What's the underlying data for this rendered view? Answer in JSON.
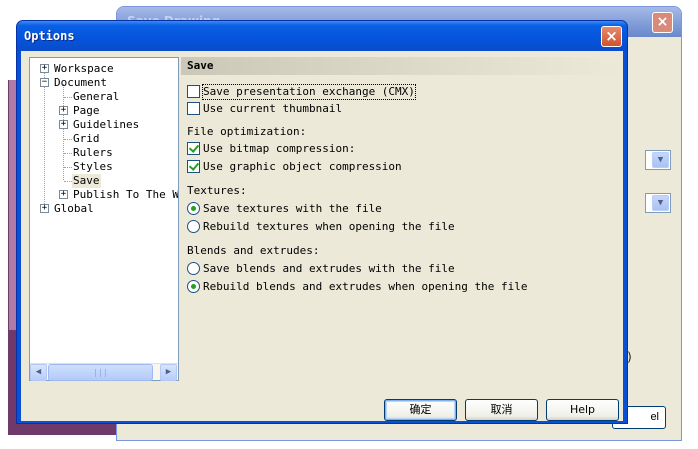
{
  "dialog": {
    "title": "Options",
    "close_label": "×"
  },
  "back_window": {
    "title": "Save Drawing",
    "close_label": "×",
    "glyph_right": ")",
    "fragment_text": "t",
    "cancel_fragment": "el"
  },
  "tree": {
    "items": [
      {
        "label": "Workspace",
        "expander": "+"
      },
      {
        "label": "Document",
        "expander": "−"
      },
      {
        "label": "General",
        "expander": ""
      },
      {
        "label": "Page",
        "expander": "+"
      },
      {
        "label": "Guidelines",
        "expander": "+"
      },
      {
        "label": "Grid",
        "expander": ""
      },
      {
        "label": "Rulers",
        "expander": ""
      },
      {
        "label": "Styles",
        "expander": ""
      },
      {
        "label": "Save",
        "expander": ""
      },
      {
        "label": "Publish To The We",
        "expander": "+"
      },
      {
        "label": "Global",
        "expander": "+"
      }
    ],
    "scroll_left": "◀",
    "scroll_right": "▶",
    "scroll_grip": "|||"
  },
  "page": {
    "heading": "Save",
    "save_cmx": {
      "text": "Save presentation exchange (CMX)",
      "checked": false
    },
    "use_thumbnail": {
      "text": "Use current thumbnail",
      "checked": false
    },
    "file_optimization_label": "File optimization:",
    "bitmap_compression": {
      "text": "Use bitmap compression:",
      "checked": true
    },
    "graphic_compression": {
      "text": "Use graphic object compression",
      "checked": true
    },
    "textures_label": "Textures:",
    "save_textures": {
      "text": "Save textures with the file",
      "selected": true
    },
    "rebuild_textures": {
      "text": "Rebuild textures when opening the file",
      "selected": false
    },
    "blends_label": "Blends and extrudes:",
    "save_blends": {
      "text": "Save blends and extrudes with the file",
      "selected": false
    },
    "rebuild_blends": {
      "text": "Rebuild blends and extrudes when opening the file",
      "selected": true
    }
  },
  "buttons": {
    "ok": "确定",
    "cancel": "取消",
    "help": "Help"
  },
  "colors": {
    "title_bar": "#0554dc",
    "check_mark": "#21a121",
    "dialog_face": "#ece9d8"
  }
}
